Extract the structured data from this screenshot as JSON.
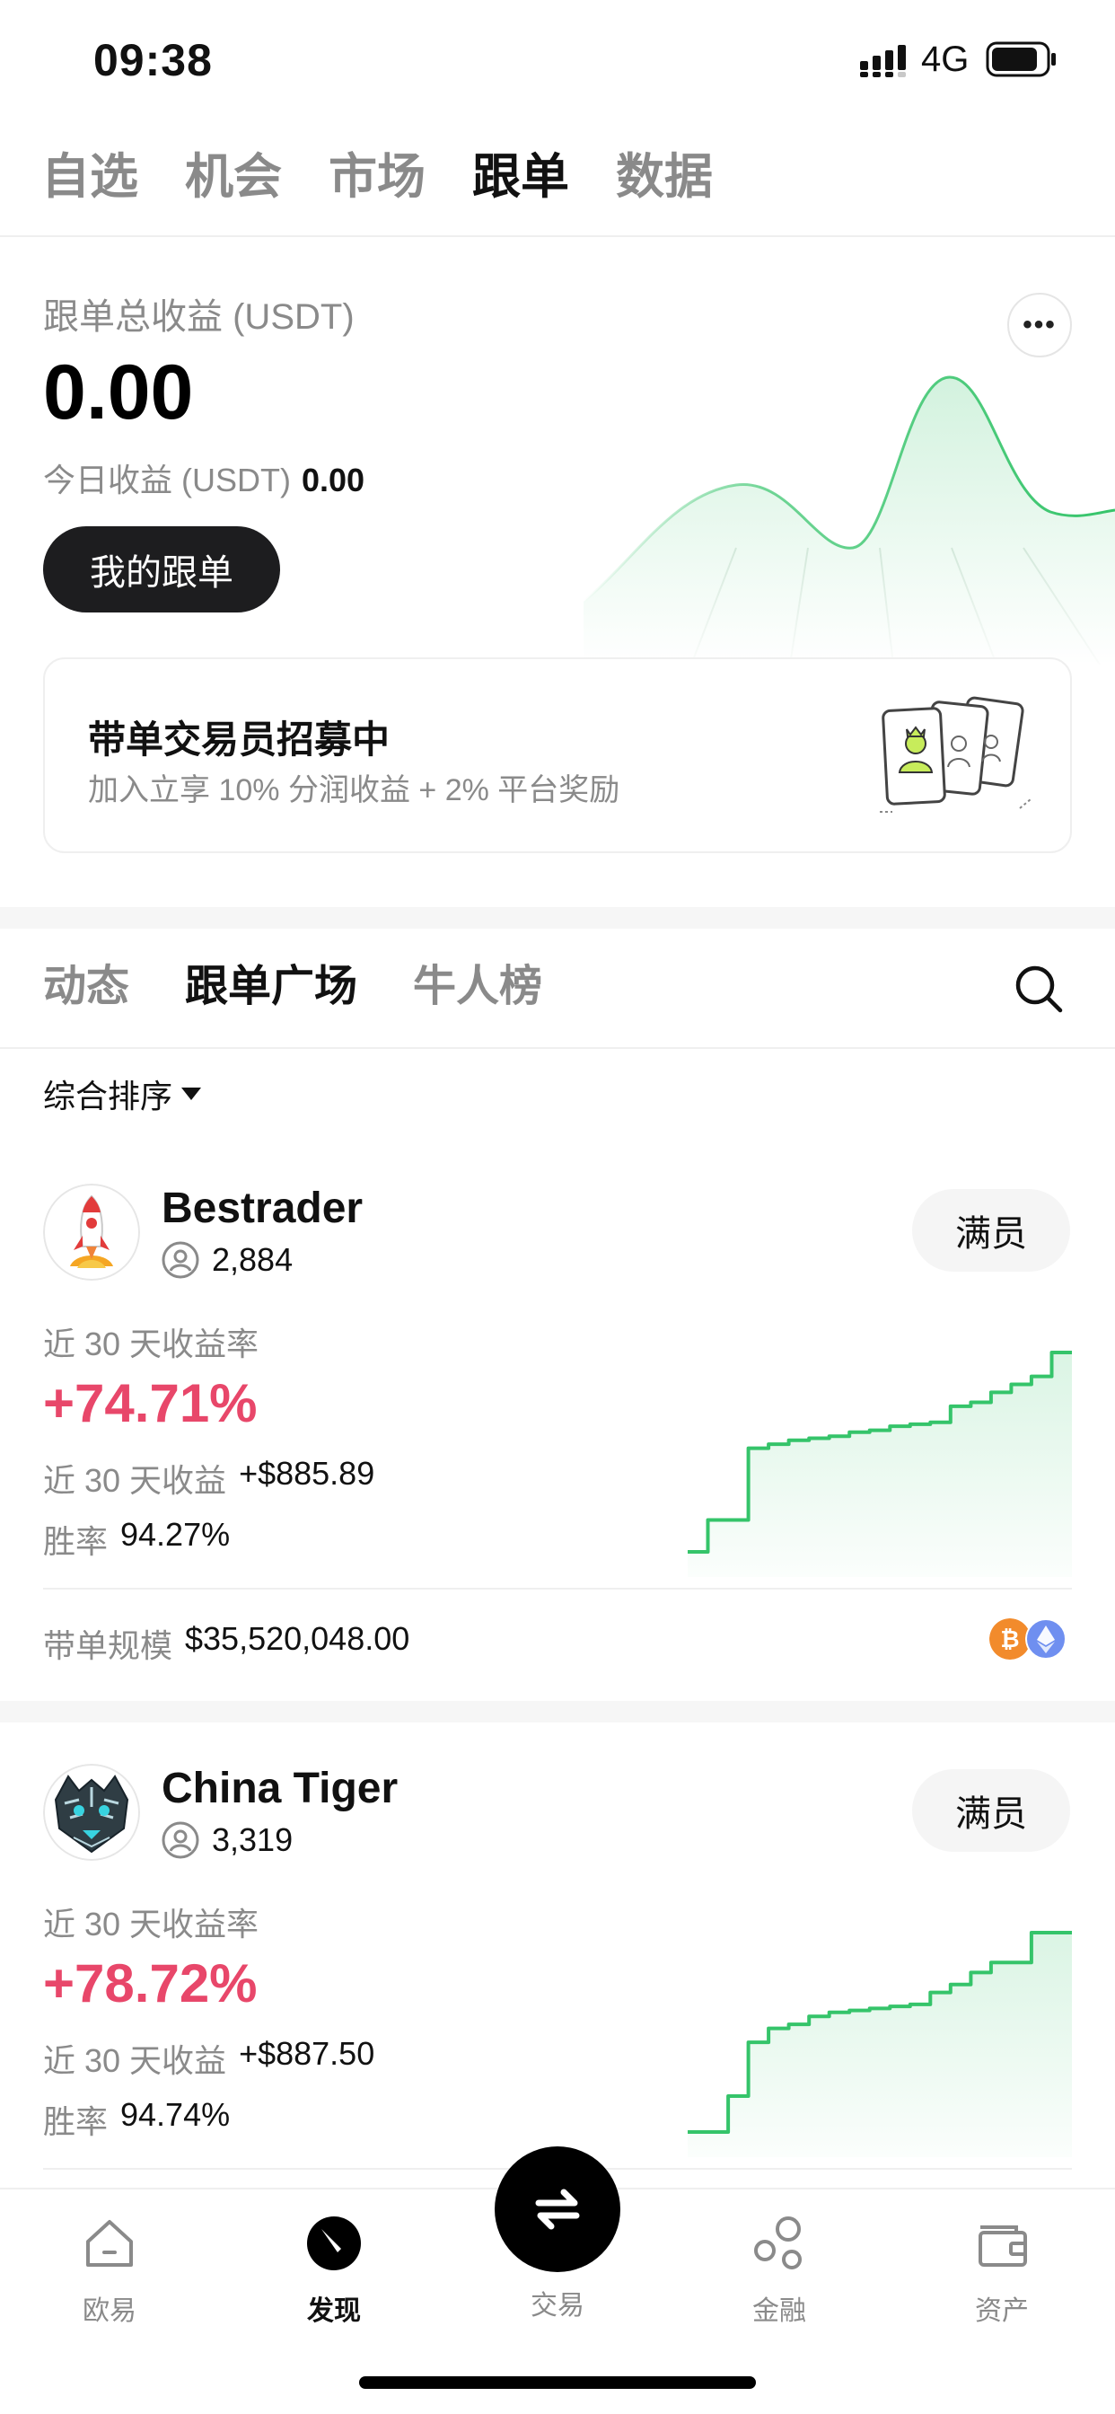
{
  "status_bar": {
    "time": "09:38",
    "network": "4G"
  },
  "top_nav": {
    "tabs": [
      {
        "label": "自选"
      },
      {
        "label": "机会"
      },
      {
        "label": "市场"
      },
      {
        "label": "跟单",
        "active": true
      },
      {
        "label": "数据"
      }
    ]
  },
  "summary": {
    "title": "跟单总收益 (USDT)",
    "value": "0.00",
    "today_label": "今日收益 (USDT)",
    "today_value": "0.00",
    "my_copy_button": "我的跟单",
    "more_icon": "more-dots-icon"
  },
  "recruit": {
    "title": "带单交易员招募中",
    "subtitle": "加入立享 10% 分润收益 + 2% 平台奖励"
  },
  "sub_tabs": {
    "tabs": [
      {
        "label": "动态"
      },
      {
        "label": "跟单广场",
        "active": true
      },
      {
        "label": "牛人榜"
      }
    ]
  },
  "sort": {
    "label": "综合排序"
  },
  "traders": [
    {
      "name": "Bestrader",
      "followers": "2,884",
      "status_button": "满员",
      "roi_label": "近 30 天收益率",
      "roi": "+74.71%",
      "pnl_label": "近 30 天收益",
      "pnl": "+$885.89",
      "win_label": "胜率",
      "win": "94.27%",
      "aum_label": "带单规模",
      "aum": "$35,520,048.00",
      "coins": [
        "bitcoin-icon",
        "ethereum-icon"
      ],
      "curve": [
        0,
        0.16,
        0.16,
        0.52,
        0.54,
        0.56,
        0.57,
        0.58,
        0.6,
        0.61,
        0.63,
        0.64,
        0.65,
        0.73,
        0.75,
        0.8,
        0.84,
        0.88,
        1.0,
        1.0
      ]
    },
    {
      "name": "China Tiger",
      "followers": "3,319",
      "status_button": "满员",
      "roi_label": "近 30 天收益率",
      "roi": "+78.72%",
      "pnl_label": "近 30 天收益",
      "pnl": "+$887.50",
      "win_label": "胜率",
      "win": "94.74%",
      "curve": [
        0,
        0,
        0.18,
        0.45,
        0.52,
        0.54,
        0.58,
        0.6,
        0.61,
        0.62,
        0.63,
        0.64,
        0.7,
        0.74,
        0.8,
        0.85,
        0.85,
        1.0,
        1.0,
        1.0
      ]
    }
  ],
  "bottom_nav": {
    "items": [
      {
        "label": "欧易",
        "icon": "home-icon"
      },
      {
        "label": "发现",
        "icon": "discover-icon",
        "active": true
      },
      {
        "label": "交易",
        "icon": "swap-icon"
      },
      {
        "label": "金融",
        "icon": "finance-icon"
      },
      {
        "label": "资产",
        "icon": "wallet-icon"
      }
    ]
  },
  "colors": {
    "accent_green": "#35c46a",
    "roi_red": "#e8476a",
    "dark_button": "#1d1d1f"
  }
}
